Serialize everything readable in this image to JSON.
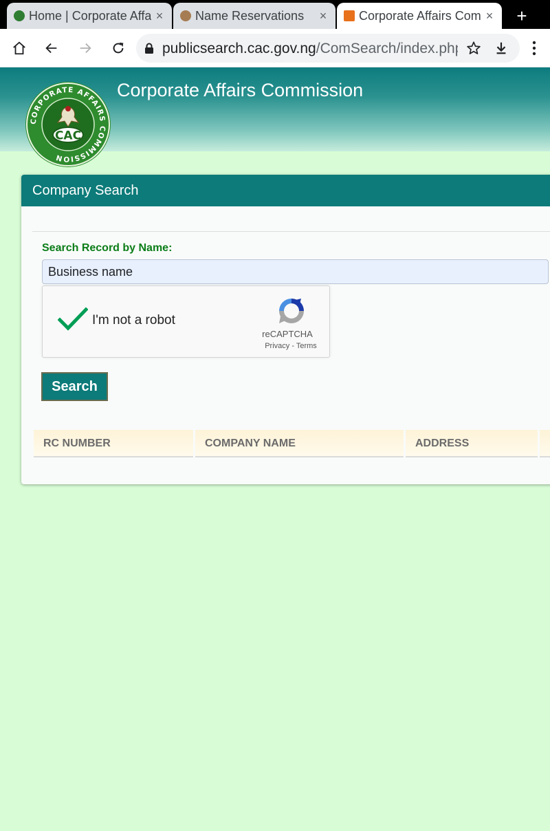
{
  "browser": {
    "tabs": [
      {
        "title": "Home | Corporate Affairs Commission",
        "close": "×",
        "favicon": "cac-logo-icon",
        "active": false
      },
      {
        "title": "Name Reservations",
        "close": "×",
        "favicon": "coat-of-arms-icon",
        "active": false
      },
      {
        "title": "Corporate Affairs Commission",
        "close": "×",
        "favicon": "orange-square-icon",
        "active": true
      }
    ],
    "new_tab": "+",
    "url_domain": "publicsearch.cac.gov.ng",
    "url_path": "/ComSearch/index.php"
  },
  "header": {
    "title": "Corporate Affairs Commission",
    "logo_text": "CAC",
    "logo_ring_text": "CORPORATE AFFAIRS COMMISSION"
  },
  "panel": {
    "title": "Company Search",
    "search_label": "Search Record by Name:",
    "search_value": "Business name",
    "search_button": "Search"
  },
  "recaptcha": {
    "label": "I'm not a robot",
    "brand": "reCAPTCHA",
    "privacy": "Privacy",
    "separator": " - ",
    "terms": "Terms",
    "checked": true
  },
  "table": {
    "columns": [
      "RC NUMBER",
      "COMPANY NAME",
      "ADDRESS"
    ]
  },
  "colors": {
    "page_bg": "#d8fdd6",
    "header_teal": "#0d7c7e",
    "panel_head": "#0c7b79",
    "label_green": "#0b7d18",
    "check_green": "#009e55"
  }
}
